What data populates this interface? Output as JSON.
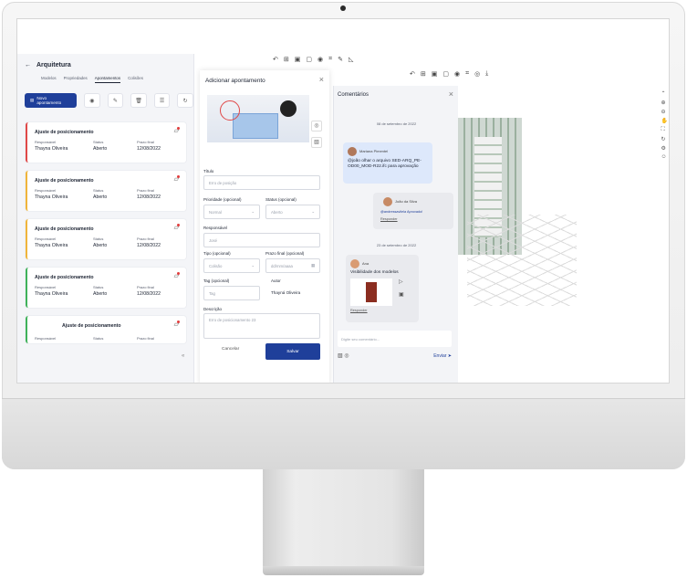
{
  "project": {
    "title": "Arquitetura"
  },
  "tabs": [
    "Modelos",
    "Propriedades",
    "Apontamentos",
    "Colisões"
  ],
  "active_tab": "Apontamentos",
  "new_button": "Novo apontamento",
  "cards": [
    {
      "title": "Ajuste de posicionamento",
      "responsavel_label": "Responsável",
      "status_label": "Status",
      "prazo_label": "Prazo final",
      "responsavel": "Thayna Oliveira",
      "status": "Aberto",
      "prazo": "12/08/2022",
      "color": "#e04848"
    },
    {
      "title": "Ajuste de posicionamento",
      "responsavel_label": "Responsável",
      "status_label": "Status",
      "prazo_label": "Prazo final",
      "responsavel": "Thayna Oliveira",
      "status": "Aberto",
      "prazo": "12/08/2022",
      "color": "#f0b53a"
    },
    {
      "title": "Ajuste de posicionamento",
      "responsavel_label": "Responsável",
      "status_label": "Status",
      "prazo_label": "Prazo final",
      "responsavel": "Thayna Oliveira",
      "status": "Aberto",
      "prazo": "12/08/2022",
      "color": "#f0b53a"
    },
    {
      "title": "Ajuste de posicionamento",
      "responsavel_label": "Responsável",
      "status_label": "Status",
      "prazo_label": "Prazo final",
      "responsavel": "Thayna Oliveira",
      "status": "Aberto",
      "prazo": "12/08/2022",
      "color": "#3fb25a"
    },
    {
      "title": "Ajuste de posicionamento",
      "responsavel_label": "Responsável",
      "status_label": "Status",
      "prazo_label": "Prazo final",
      "responsavel": "",
      "status": "",
      "prazo": "",
      "color": "#3fb25a"
    }
  ],
  "modal": {
    "title": "Adicionar apontamento",
    "titulo_label": "Título",
    "titulo_placeholder": "Erro de posição",
    "prioridade_label": "Prioridade (opcional)",
    "prioridade_value": "Normal",
    "status_label": "Status (opcional)",
    "status_value": "Aberto",
    "responsavel_label": "Responsável",
    "responsavel_value": "José",
    "tipo_label": "Tipo (opcional)",
    "tipo_value": "Colisão",
    "prazo_label": "Prazo final (opcional)",
    "prazo_placeholder": "dd/mm/aaaa",
    "tag_label": "Tag (opcional)",
    "tag_value": "Tag",
    "autor_label": "Autor",
    "autor_value": "Thayná Oliveira",
    "descricao_label": "Descrição",
    "descricao_value": "Erro de posicionamento 23",
    "cancel": "Cancelar",
    "save": "Salvar"
  },
  "comments": {
    "title": "Comentários",
    "date1": "08 de setembro de 2022",
    "c1_author": "Mariana Pimentel",
    "c1_text": "@joão olhar o arquivo SED-ARQ_PE-OD00_MOD-R22.ifc para aprovação",
    "c2_author": "João da Silva",
    "c2_text": "@andressavilela Aprovado!",
    "c2_reply": "Responder",
    "date2": "23 de setembro de 2022",
    "c3_author": "Ana",
    "c3_text": "Visibilidade dos modelos",
    "c3_reply": "Responder",
    "input_placeholder": "Digite seu comentário...",
    "send": "Enviar"
  }
}
